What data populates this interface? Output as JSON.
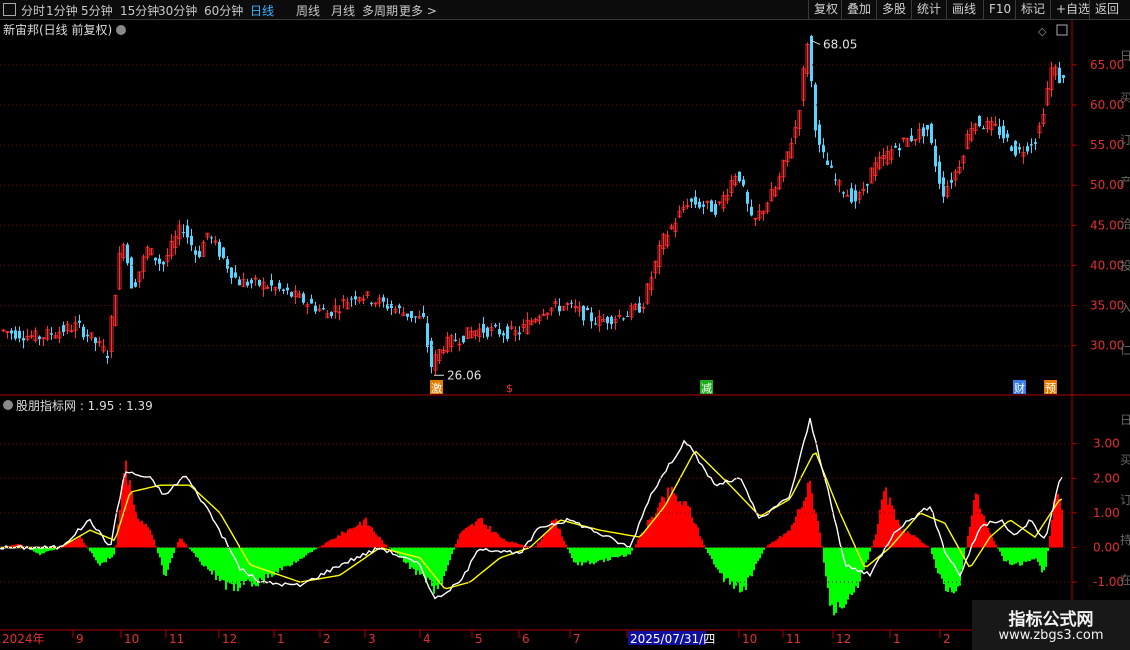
{
  "toolbar": {
    "left_items": [
      "分时",
      "1分钟",
      "5分钟",
      "15分钟",
      "30分钟",
      "60分钟",
      "日线",
      "周线",
      "月线",
      "多周期",
      "更多 >"
    ],
    "active_item": "日线",
    "right_buttons": [
      "复权",
      "叠加",
      "多股",
      "统计",
      "画线",
      "F10",
      "标记",
      "+自选",
      "返回"
    ]
  },
  "main_chart": {
    "stock_name": "新宙邦",
    "period_label": "(日线 前复权)",
    "high_annotation": "68.05",
    "low_annotation": "26.06",
    "price_ticks": [
      "65.00",
      "60.00",
      "55.00",
      "50.00",
      "45.00",
      "40.00",
      "35.00",
      "30.00"
    ],
    "event_markers": [
      {
        "label": "激",
        "color": "#ff8a00"
      },
      {
        "label": "$",
        "color": "#ff3030"
      },
      {
        "label": "减",
        "color": "#22c022"
      },
      {
        "label": "财",
        "color": "#3c8cff"
      },
      {
        "label": "预",
        "color": "#ff8a00"
      }
    ],
    "right_axis_partial": [
      "日",
      "买",
      "订",
      "产",
      "洽",
      "投",
      "入",
      "仁"
    ]
  },
  "indicator": {
    "name": "股朋指标网",
    "value1": ": 1.95",
    "value2": ": 1.39",
    "ticks": [
      "3.00",
      "2.00",
      "1.00",
      "0.00",
      "-1.00"
    ],
    "right_axis_partial": [
      "日",
      "买",
      "订",
      "持",
      "在"
    ]
  },
  "date_axis": {
    "labels": [
      "2024年",
      "9",
      "10",
      "11",
      "12",
      "1",
      "2",
      "3",
      "4",
      "5",
      "6",
      "7",
      "2025/07/31/四",
      "10",
      "11",
      "12",
      "1",
      "2"
    ]
  },
  "watermark": {
    "title": "指标公式网",
    "url": "www.zbgs3.com"
  },
  "colors": {
    "up": "#ff3030",
    "down": "#55d5ff",
    "hist_pos": "#ff0000",
    "hist_neg": "#00ff00",
    "line_white": "#ffffff",
    "line_yellow": "#ffff00",
    "grid": "#8b0000"
  },
  "price_keypoints": [
    [
      0,
      32
    ],
    [
      40,
      31
    ],
    [
      80,
      32.5
    ],
    [
      110,
      29
    ],
    [
      125,
      44
    ],
    [
      135,
      37
    ],
    [
      150,
      42
    ],
    [
      165,
      40
    ],
    [
      185,
      45
    ],
    [
      200,
      41
    ],
    [
      210,
      44
    ],
    [
      240,
      38
    ],
    [
      270,
      37.5
    ],
    [
      300,
      36
    ],
    [
      330,
      34
    ],
    [
      360,
      36.5
    ],
    [
      390,
      35
    ],
    [
      428,
      33
    ],
    [
      432,
      27
    ],
    [
      445,
      30
    ],
    [
      480,
      32
    ],
    [
      520,
      31.5
    ],
    [
      545,
      34.5
    ],
    [
      570,
      35
    ],
    [
      600,
      33
    ],
    [
      630,
      34
    ],
    [
      645,
      35
    ],
    [
      665,
      43
    ],
    [
      690,
      48
    ],
    [
      720,
      47
    ],
    [
      740,
      52
    ],
    [
      755,
      45
    ],
    [
      780,
      50
    ],
    [
      800,
      58
    ],
    [
      810,
      68
    ],
    [
      820,
      55
    ],
    [
      840,
      50
    ],
    [
      860,
      48
    ],
    [
      875,
      52
    ],
    [
      900,
      55
    ],
    [
      930,
      57
    ],
    [
      945,
      49
    ],
    [
      960,
      52
    ],
    [
      975,
      58
    ],
    [
      1000,
      57
    ],
    [
      1020,
      54
    ],
    [
      1040,
      56
    ],
    [
      1055,
      65
    ],
    [
      1063,
      63
    ]
  ],
  "white_keypoints": [
    [
      0,
      0
    ],
    [
      60,
      0
    ],
    [
      90,
      0.8
    ],
    [
      110,
      0
    ],
    [
      125,
      2.2
    ],
    [
      150,
      2.0
    ],
    [
      165,
      1.5
    ],
    [
      185,
      2.1
    ],
    [
      210,
      1.0
    ],
    [
      240,
      -0.6
    ],
    [
      260,
      -1.0
    ],
    [
      300,
      -1.1
    ],
    [
      340,
      -0.5
    ],
    [
      380,
      0
    ],
    [
      420,
      -0.5
    ],
    [
      435,
      -1.5
    ],
    [
      460,
      -1.0
    ],
    [
      480,
      0
    ],
    [
      520,
      -0.2
    ],
    [
      540,
      0.6
    ],
    [
      570,
      0.8
    ],
    [
      600,
      0.4
    ],
    [
      630,
      0
    ],
    [
      650,
      1.5
    ],
    [
      685,
      3.1
    ],
    [
      715,
      1.8
    ],
    [
      740,
      2.0
    ],
    [
      760,
      0.8
    ],
    [
      790,
      1.5
    ],
    [
      810,
      3.7
    ],
    [
      825,
      2.0
    ],
    [
      845,
      -0.5
    ],
    [
      870,
      -0.8
    ],
    [
      895,
      0.5
    ],
    [
      930,
      1.2
    ],
    [
      945,
      -0.1
    ],
    [
      960,
      -0.8
    ],
    [
      980,
      0.6
    ],
    [
      1000,
      0.8
    ],
    [
      1015,
      0.3
    ],
    [
      1030,
      0.8
    ],
    [
      1045,
      0.2
    ],
    [
      1060,
      2.0
    ]
  ],
  "yellow_keypoints": [
    [
      0,
      0
    ],
    [
      60,
      0
    ],
    [
      90,
      0.5
    ],
    [
      115,
      0.2
    ],
    [
      130,
      1.6
    ],
    [
      160,
      1.8
    ],
    [
      190,
      1.8
    ],
    [
      220,
      1.0
    ],
    [
      250,
      -0.5
    ],
    [
      300,
      -1.0
    ],
    [
      340,
      -0.8
    ],
    [
      380,
      0
    ],
    [
      420,
      -0.3
    ],
    [
      445,
      -1.2
    ],
    [
      470,
      -1.0
    ],
    [
      500,
      -0.3
    ],
    [
      530,
      0
    ],
    [
      560,
      0.8
    ],
    [
      600,
      0.5
    ],
    [
      640,
      0.3
    ],
    [
      665,
      1.2
    ],
    [
      695,
      2.8
    ],
    [
      730,
      1.8
    ],
    [
      760,
      0.9
    ],
    [
      790,
      1.4
    ],
    [
      815,
      2.8
    ],
    [
      840,
      1.0
    ],
    [
      865,
      -0.6
    ],
    [
      890,
      0
    ],
    [
      920,
      1.0
    ],
    [
      945,
      0.7
    ],
    [
      970,
      -0.6
    ],
    [
      990,
      0.3
    ],
    [
      1010,
      0.8
    ],
    [
      1035,
      0.3
    ],
    [
      1060,
      1.4
    ]
  ],
  "hist_keypoints": [
    [
      0,
      0
    ],
    [
      20,
      0.1
    ],
    [
      40,
      -0.2
    ],
    [
      60,
      0
    ],
    [
      80,
      0.3
    ],
    [
      100,
      -0.5
    ],
    [
      115,
      -0.2
    ],
    [
      125,
      2.5
    ],
    [
      135,
      1.0
    ],
    [
      150,
      0.6
    ],
    [
      165,
      -0.8
    ],
    [
      180,
      0.3
    ],
    [
      200,
      -0.4
    ],
    [
      230,
      -1.2
    ],
    [
      260,
      -1.0
    ],
    [
      290,
      -0.5
    ],
    [
      330,
      0.2
    ],
    [
      365,
      0.8
    ],
    [
      385,
      0.1
    ],
    [
      420,
      -0.8
    ],
    [
      438,
      -1.3
    ],
    [
      460,
      0.4
    ],
    [
      480,
      0.8
    ],
    [
      505,
      0.2
    ],
    [
      535,
      0
    ],
    [
      555,
      0.8
    ],
    [
      575,
      -0.5
    ],
    [
      600,
      -0.4
    ],
    [
      630,
      -0.2
    ],
    [
      650,
      0.8
    ],
    [
      670,
      1.6
    ],
    [
      690,
      1.1
    ],
    [
      705,
      0
    ],
    [
      725,
      -1.0
    ],
    [
      745,
      -1.2
    ],
    [
      765,
      0
    ],
    [
      790,
      0.5
    ],
    [
      810,
      1.8
    ],
    [
      820,
      0.5
    ],
    [
      830,
      -1.8
    ],
    [
      845,
      -1.5
    ],
    [
      860,
      -1.0
    ],
    [
      875,
      0.3
    ],
    [
      885,
      1.6
    ],
    [
      900,
      0.6
    ],
    [
      930,
      0
    ],
    [
      945,
      -1.3
    ],
    [
      960,
      -1.1
    ],
    [
      975,
      1.6
    ],
    [
      990,
      0.4
    ],
    [
      1005,
      -0.4
    ],
    [
      1020,
      -0.5
    ],
    [
      1035,
      -0.3
    ],
    [
      1045,
      -0.8
    ],
    [
      1055,
      1.5
    ],
    [
      1065,
      1.1
    ]
  ]
}
